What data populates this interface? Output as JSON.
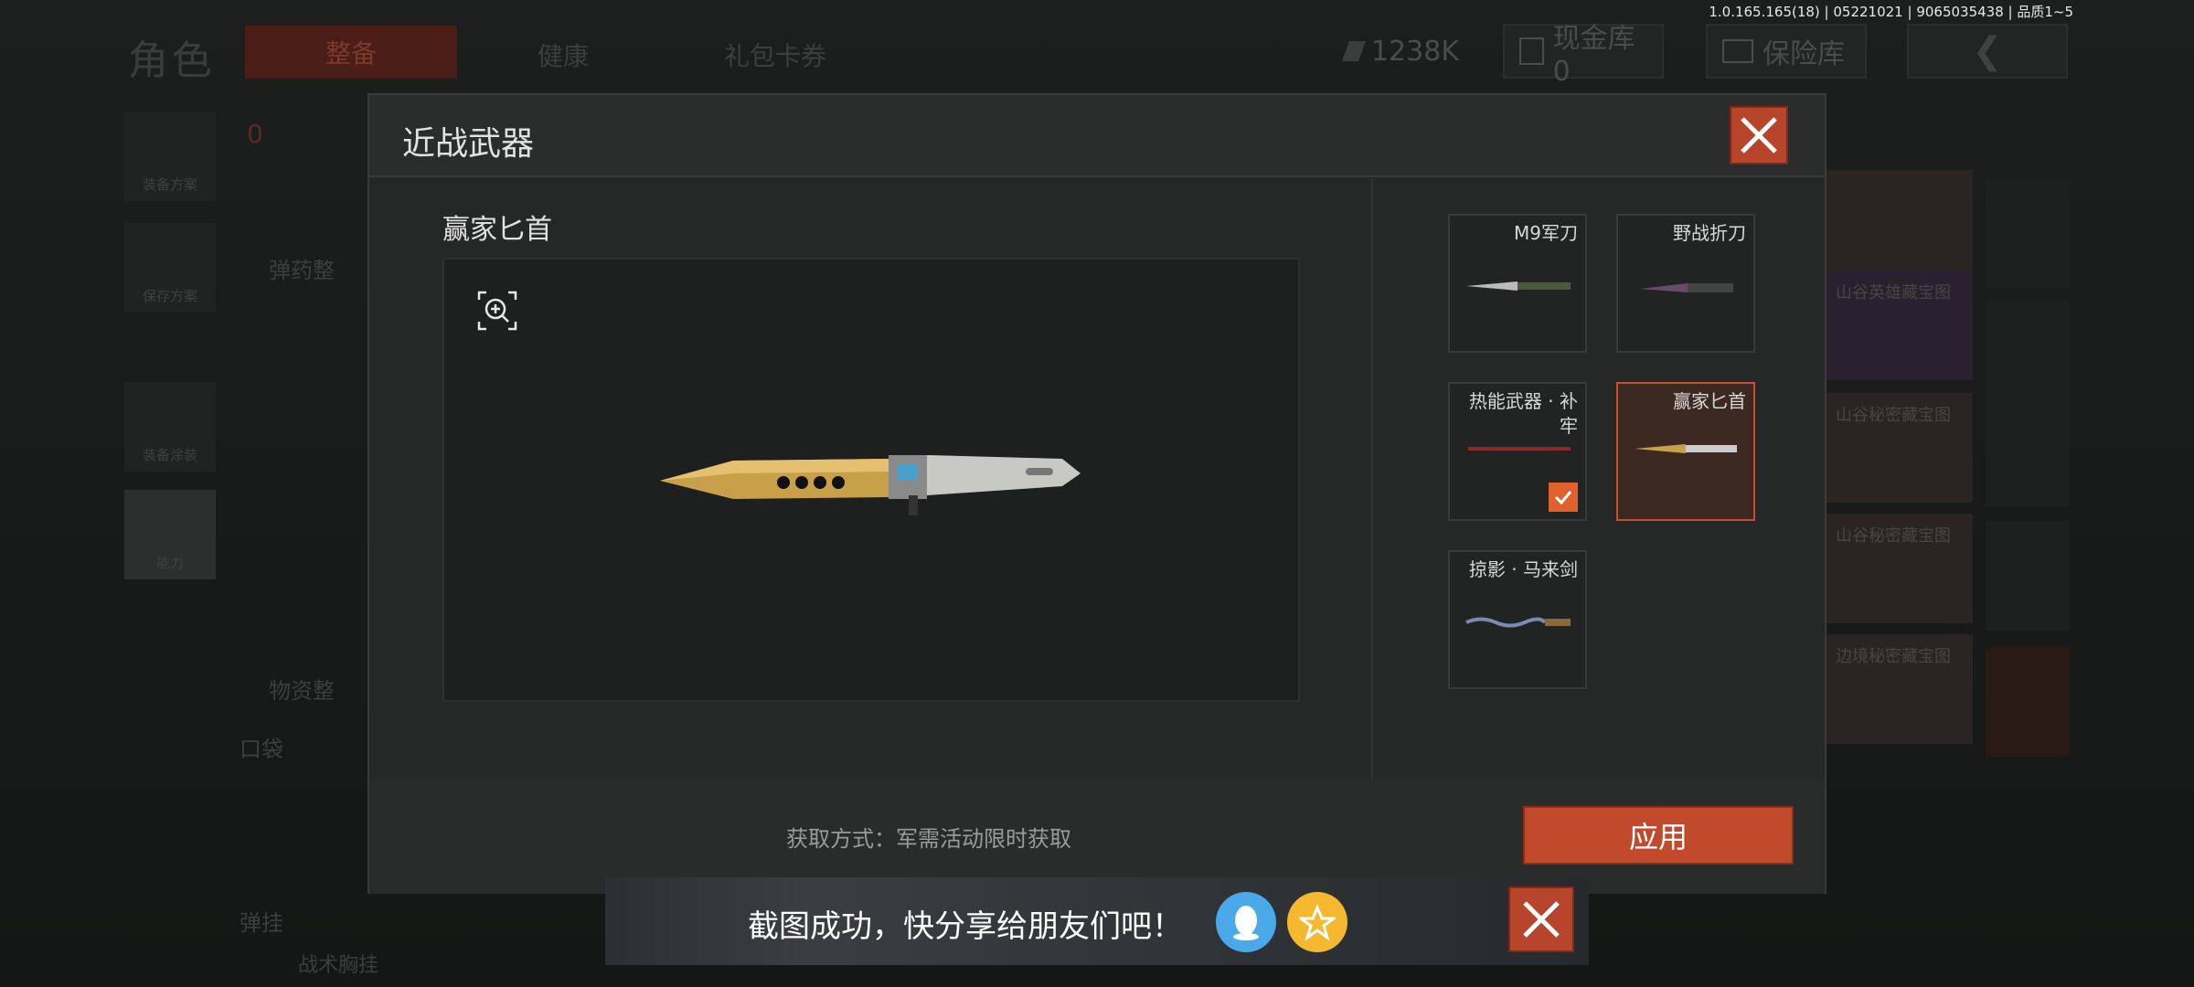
{
  "version": "1.0.165.165(18) | 05221021 | 9065035438 | 品质1~5",
  "background": {
    "title": "角色",
    "tabs": [
      "整备",
      "健康",
      "礼包卡券"
    ],
    "currency": "1238K",
    "cash_store": "现金库 0",
    "safe_store": "保险库",
    "left_items": [
      "装备方案",
      "保存方案",
      "装备涂装",
      "能力"
    ],
    "section_labels": [
      "弹药整",
      "物资整",
      "口袋",
      "弹挂",
      "战术胸挂"
    ],
    "slot_count": "0",
    "right_cards": [
      "山谷英雄藏宝图",
      "山谷秘密藏宝图",
      "山谷秘密藏宝图",
      "边境秘密藏宝图"
    ]
  },
  "modal": {
    "title": "近战武器",
    "preview_title": "赢家匕首",
    "items": [
      {
        "label": "M9军刀",
        "selected": false,
        "equipped": false
      },
      {
        "label": "野战折刀",
        "selected": false,
        "equipped": false
      },
      {
        "label": "热能武器 · 补牢",
        "selected": false,
        "equipped": true
      },
      {
        "label": "赢家匕首",
        "selected": true,
        "equipped": false
      },
      {
        "label": "掠影 · 马来剑",
        "selected": false,
        "equipped": false
      }
    ],
    "obtain_text": "获取方式：军需活动限时获取",
    "apply_label": "应用"
  },
  "toast": {
    "text": "截图成功，快分享给朋友们吧！",
    "share_icons": [
      "qq-icon",
      "qzone-icon"
    ]
  },
  "colors": {
    "accent": "#c24a2c",
    "check": "#e0602e",
    "qq": "#4aa9e8",
    "qzone": "#f5b82e"
  }
}
